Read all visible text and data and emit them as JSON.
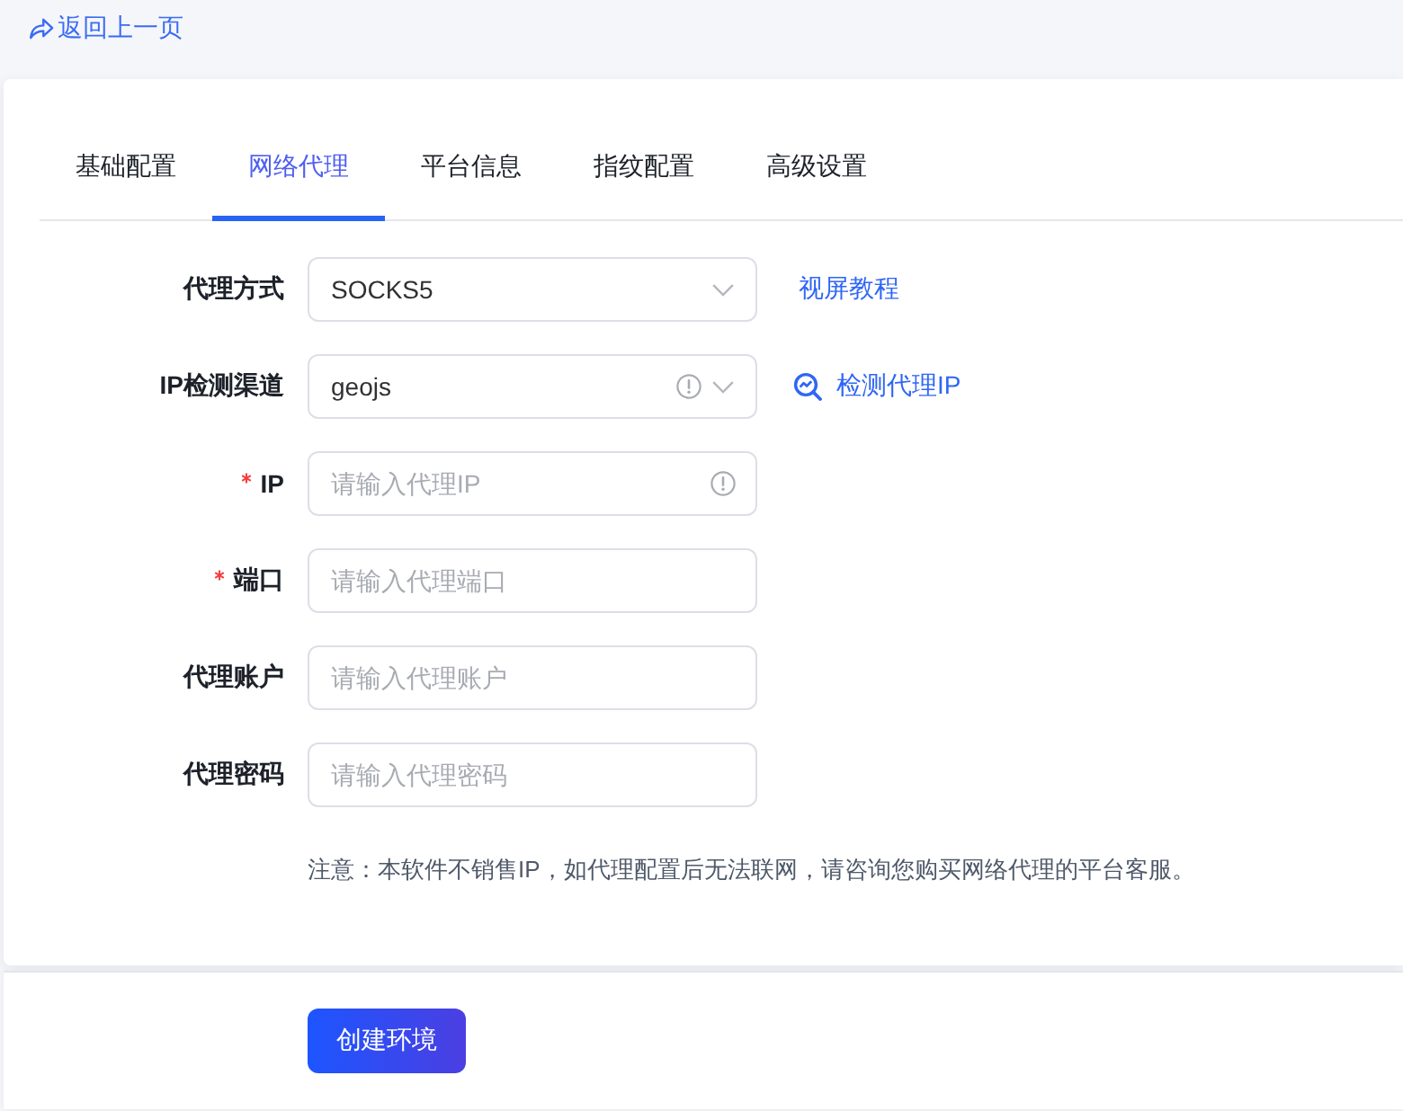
{
  "back_link": {
    "label": "返回上一页"
  },
  "tabs": [
    {
      "label": "基础配置",
      "selected": false
    },
    {
      "label": "网络代理",
      "selected": true
    },
    {
      "label": "平台信息",
      "selected": false
    },
    {
      "label": "指纹配置",
      "selected": false
    },
    {
      "label": "高级设置",
      "selected": false
    }
  ],
  "form": {
    "fields": [
      {
        "kind": "select",
        "label": "代理方式",
        "required": false,
        "value": "SOCKS5",
        "info_icon": false,
        "action": {
          "kind": "link",
          "label": "视屏教程"
        }
      },
      {
        "kind": "select",
        "label": "IP检测渠道",
        "required": false,
        "value": "geojs",
        "info_icon": true,
        "action": {
          "kind": "icon_link",
          "label": "检测代理IP"
        }
      },
      {
        "kind": "input",
        "label": "IP",
        "required": true,
        "placeholder": "请输入代理IP",
        "info_icon": true
      },
      {
        "kind": "input",
        "label": "端口",
        "required": true,
        "placeholder": "请输入代理端口",
        "info_icon": false
      },
      {
        "kind": "input",
        "label": "代理账户",
        "required": false,
        "placeholder": "请输入代理账户",
        "info_icon": false
      },
      {
        "kind": "input",
        "label": "代理密码",
        "required": false,
        "placeholder": "请输入代理密码",
        "info_icon": false
      }
    ],
    "note": "注意：本软件不销售IP，如代理配置后无法联网，请咨询您购买网络代理的平台客服。"
  },
  "footer": {
    "buttons": [
      "创建环境"
    ]
  }
}
